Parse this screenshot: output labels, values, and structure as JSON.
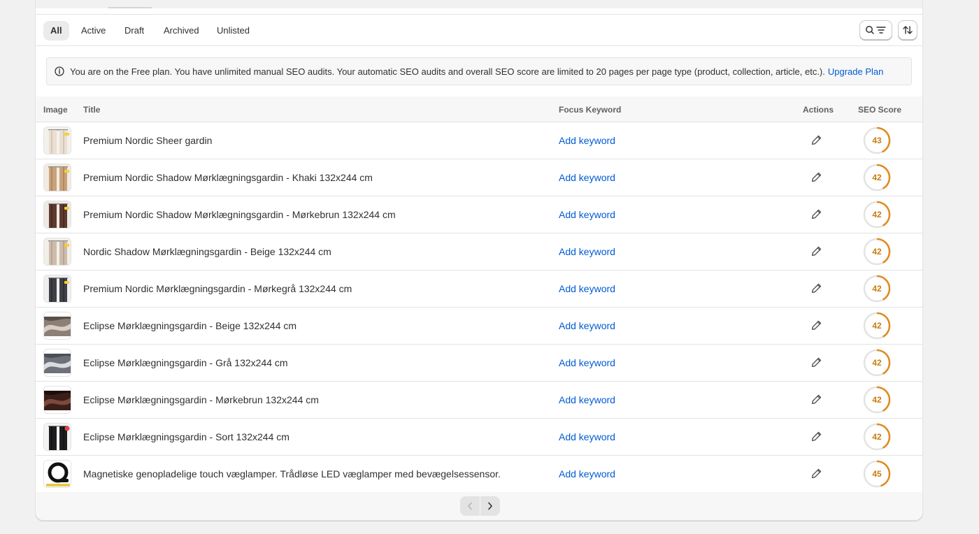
{
  "tabs": [
    {
      "label": "All",
      "selected": true
    },
    {
      "label": "Active",
      "selected": false
    },
    {
      "label": "Draft",
      "selected": false
    },
    {
      "label": "Archived",
      "selected": false
    },
    {
      "label": "Unlisted",
      "selected": false
    }
  ],
  "toolbar": {
    "search_filter_icon": "search-filter-icon",
    "sort_icon": "sort-icon"
  },
  "banner": {
    "text": "You are on the Free plan. You have unlimited manual SEO audits. Your automatic SEO audits and overall SEO score are limited to 20 pages per page type (product, collection, article, etc.).",
    "link": "Upgrade Plan",
    "icon": "info-icon"
  },
  "columns": {
    "image": "Image",
    "title": "Title",
    "focus_keyword": "Focus Keyword",
    "actions": "Actions",
    "seo_score": "SEO Score"
  },
  "rows": [
    {
      "title": "Premium Nordic Sheer gardin",
      "keyword": "Add keyword",
      "score": "43",
      "score_pct": 43,
      "thumb": "curtain-light"
    },
    {
      "title": "Premium Nordic Shadow Mørklægningsgardin - Khaki 132x244 cm",
      "keyword": "Add keyword",
      "score": "42",
      "score_pct": 42,
      "thumb": "curtain-khaki"
    },
    {
      "title": "Premium Nordic Shadow Mørklægningsgardin - Mørkebrun 132x244 cm",
      "keyword": "Add keyword",
      "score": "42",
      "score_pct": 42,
      "thumb": "curtain-brown"
    },
    {
      "title": "Nordic Shadow Mørklægningsgardin - Beige 132x244 cm",
      "keyword": "Add keyword",
      "score": "42",
      "score_pct": 42,
      "thumb": "curtain-beige"
    },
    {
      "title": "Premium Nordic Mørklægningsgardin - Mørkegrå 132x244 cm",
      "keyword": "Add keyword",
      "score": "42",
      "score_pct": 42,
      "thumb": "curtain-darkgrey"
    },
    {
      "title": "Eclipse Mørklægningsgardin - Beige 132x244 cm",
      "keyword": "Add keyword",
      "score": "42",
      "score_pct": 42,
      "thumb": "fabric-beige"
    },
    {
      "title": "Eclipse Mørklægningsgardin - Grå 132x244 cm",
      "keyword": "Add keyword",
      "score": "42",
      "score_pct": 42,
      "thumb": "fabric-grey"
    },
    {
      "title": "Eclipse Mørklægningsgardin - Mørkebrun 132x244 cm",
      "keyword": "Add keyword",
      "score": "42",
      "score_pct": 42,
      "thumb": "fabric-brown"
    },
    {
      "title": "Eclipse Mørklægningsgardin - Sort 132x244 cm",
      "keyword": "Add keyword",
      "score": "42",
      "score_pct": 42,
      "thumb": "curtain-black"
    },
    {
      "title": "Magnetiske genopladelige touch væglamper. Trådløse LED væglamper med bevægelsessensor.",
      "keyword": "Add keyword",
      "score": "45",
      "score_pct": 45,
      "thumb": "lamp"
    }
  ],
  "colors": {
    "accent_link": "#005bd3",
    "score_ring": "#e08a1e",
    "score_text": "#c77d10"
  },
  "pagination": {
    "prev_icon": "chevron-left-icon",
    "next_icon": "chevron-right-icon",
    "prev_enabled": false
  }
}
